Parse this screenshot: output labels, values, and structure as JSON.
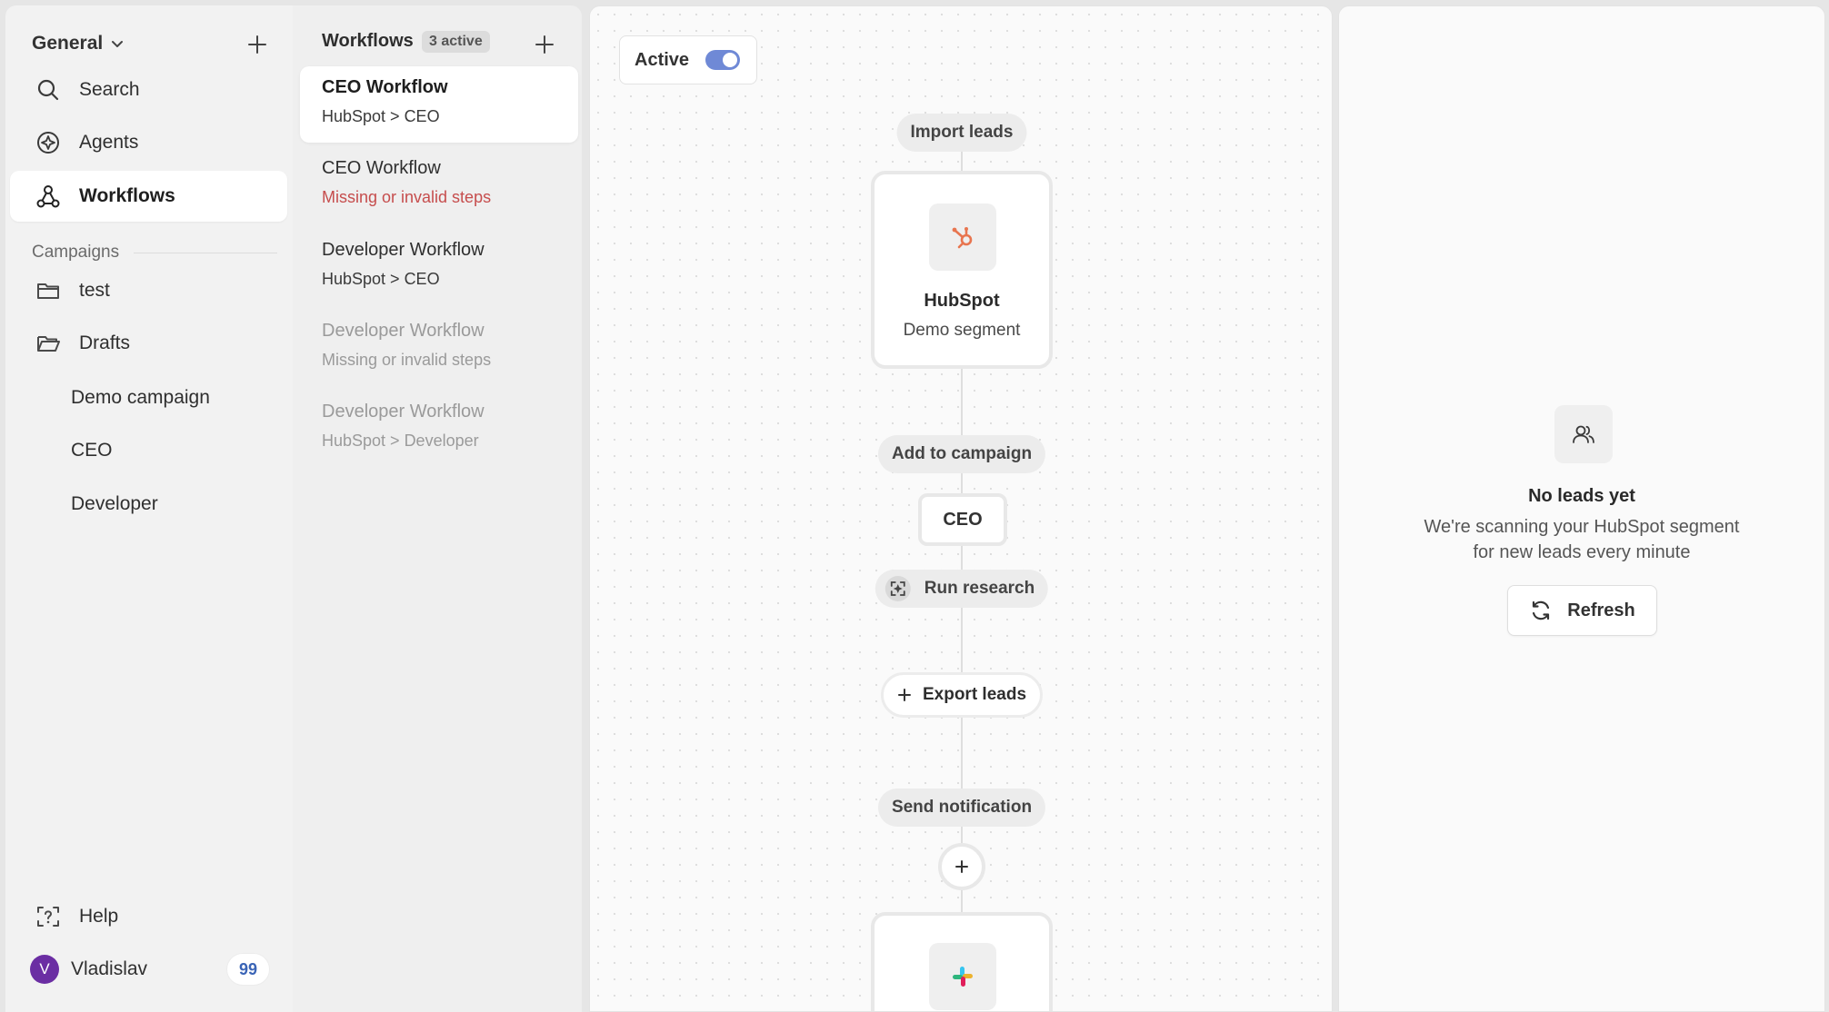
{
  "sidebar": {
    "workspace": "General",
    "nav": {
      "search": "Search",
      "agents": "Agents",
      "workflows": "Workflows"
    },
    "campaigns_label": "Campaigns",
    "folders": {
      "test": "test",
      "drafts": "Drafts"
    },
    "drafts_items": [
      "Demo campaign",
      "CEO",
      "Developer"
    ],
    "help": "Help",
    "user": {
      "initial": "V",
      "name": "Vladislav",
      "badge": "99"
    }
  },
  "workflows": {
    "title": "Workflows",
    "count": "3 active",
    "items": [
      {
        "name": "CEO Workflow",
        "sub": "HubSpot > CEO"
      },
      {
        "name": "CEO Workflow",
        "sub": "Missing or invalid steps"
      },
      {
        "name": "Developer Workflow",
        "sub": "HubSpot > CEO"
      },
      {
        "name": "Developer Workflow",
        "sub": "Missing or invalid steps"
      },
      {
        "name": "Developer Workflow",
        "sub": "HubSpot > Developer"
      }
    ]
  },
  "canvas": {
    "toggle_label": "Active",
    "toggle_on": true,
    "import_leads": "Import leads",
    "hubspot_title": "HubSpot",
    "hubspot_sub": "Demo segment",
    "add_to_campaign": "Add to campaign",
    "campaign_node": "CEO",
    "run_research": "Run research",
    "export_leads": "Export leads",
    "send_notification": "Send notification"
  },
  "leads_panel": {
    "title": "No leads yet",
    "line1": "We're scanning your HubSpot segment",
    "line2": "for new leads every minute",
    "refresh": "Refresh"
  },
  "colors": {
    "accent_toggle": "#6f89d6",
    "error_text": "#c64d4d",
    "hubspot_orange": "#e8754f",
    "avatar": "#6b2ea3",
    "badge_text": "#3a64b6"
  }
}
